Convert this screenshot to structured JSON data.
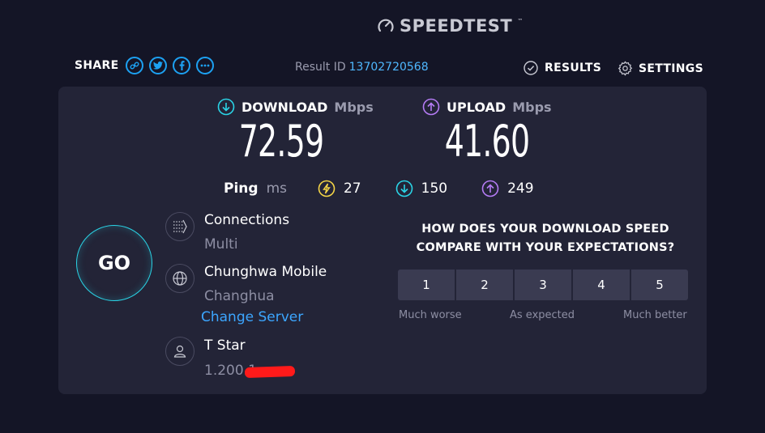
{
  "brand": {
    "name": "SPEEDTEST",
    "tm": "™"
  },
  "topbar": {
    "share_label": "SHARE",
    "share_buttons": [
      "link-icon",
      "twitter-icon",
      "facebook-icon",
      "more-icon"
    ],
    "result_id_label": "Result ID",
    "result_id_value": "13702720568",
    "results_label": "RESULTS",
    "settings_label": "SETTINGS"
  },
  "download": {
    "label": "DOWNLOAD",
    "unit": "Mbps",
    "value": "72.59"
  },
  "upload": {
    "label": "UPLOAD",
    "unit": "Mbps",
    "value": "41.60"
  },
  "ping": {
    "label": "Ping",
    "unit": "ms",
    "idle": "27",
    "download": "150",
    "upload": "249"
  },
  "go_label": "GO",
  "connections": {
    "title": "Connections",
    "value": "Multi"
  },
  "server": {
    "name": "Chunghwa Mobile",
    "location": "Changhua",
    "change_label": "Change Server"
  },
  "isp": {
    "name": "T Star",
    "ip": "1.200.1"
  },
  "survey": {
    "question_line1": "HOW DOES YOUR DOWNLOAD SPEED",
    "question_line2": "COMPARE WITH YOUR EXPECTATIONS?",
    "options": [
      "1",
      "2",
      "3",
      "4",
      "5"
    ],
    "low_label": "Much worse",
    "mid_label": "As expected",
    "high_label": "Much better"
  },
  "colors": {
    "background": "#141526",
    "panel": "#232437",
    "download_accent": "#2ad4e6",
    "upload_accent": "#b57cf5",
    "link": "#3ca6ff",
    "ping_accent": "#f5d547"
  }
}
